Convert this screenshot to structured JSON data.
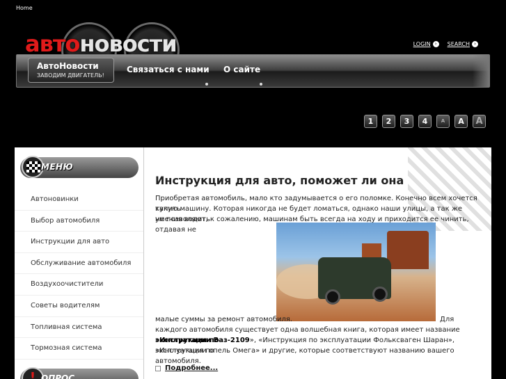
{
  "breadcrumb": "Home",
  "logo": {
    "part1": "авто",
    "part2": "новости"
  },
  "top_links": {
    "login": "LOGIN",
    "search": "SEARCH"
  },
  "nav": {
    "active_title": "АвтоНовости",
    "active_subtitle": "ЗАВОДИМ ДВИГАТЕЛЬ!",
    "items": [
      "Связаться с нами",
      "О сайте"
    ]
  },
  "toolbar": {
    "buttons": [
      "1",
      "2",
      "3",
      "4",
      "A",
      "A",
      "A"
    ]
  },
  "sidebar": {
    "menu_title": "МЕНЮ",
    "items": [
      "Автоновинки",
      "Выбор автомобиля",
      "Инструкции для авто",
      "Обслуживание автомобиля",
      "Воздухоочистители",
      "Советы водителям",
      "Топливная система",
      "Тормозная система"
    ],
    "poll_title": "ОПРОС"
  },
  "article": {
    "title": "Инструкция для авто, поможет ли она",
    "para1_l1": "Приобретая автомобиль, мало кто задумывается о его поломке. Конечно всем хочется купить",
    "para1_l2": "такую машину. Которая никогда не будет ломаться, однако наши улицы, а так же умения водить",
    "para1_l3": "не позволяют, к сожалению, машинам быть всегда на ходу и приходится ее чинить, отдавая не",
    "para2_left": "малые суммы за ремонт автомобиля.",
    "para2_right": "Для",
    "para3_l1a": "каждого автомобиля существует одна волшебная книга, которая имеет название «",
    "para3_l1b": "Инструкция по",
    "para3_l2a": "эксплуатации Ваз-2109",
    "para3_l2b": "», «Инструкция по эксплуатации Фольксваген Шаран», «Инструкция по",
    "para3_l3": "эксплуатации опель Омега» и другие, которые соответствуют названию вашего автомобиля.",
    "more": "Подробнее..."
  }
}
